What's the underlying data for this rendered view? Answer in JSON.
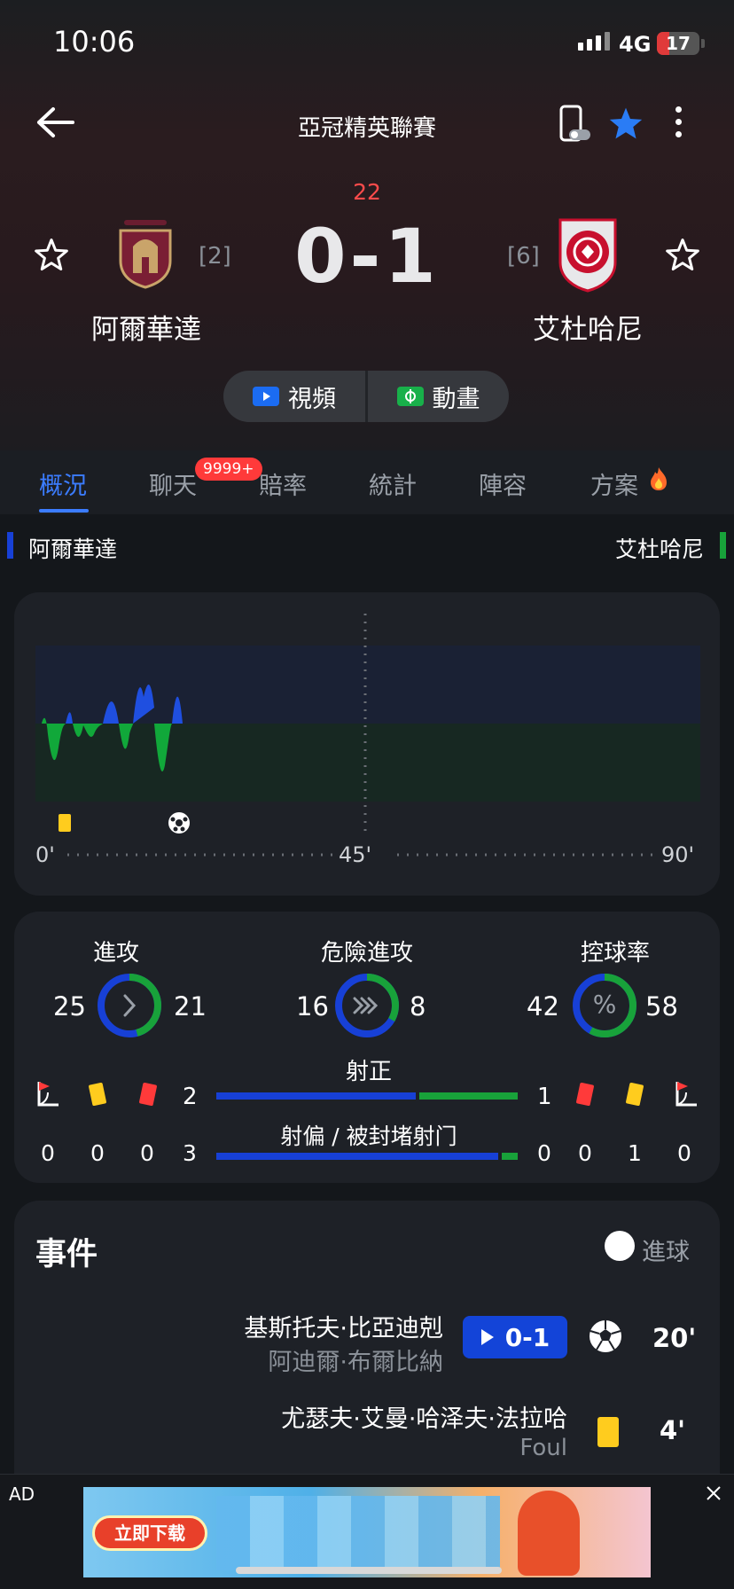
{
  "status": {
    "time": "10:06",
    "network": "4G",
    "battery": "17"
  },
  "header": {
    "title": "亞冠精英聯賽",
    "minute": "22",
    "score": "0-1",
    "home": {
      "name": "阿爾華達",
      "rank": "[2]"
    },
    "away": {
      "name": "艾杜哈尼",
      "rank": "[6]"
    },
    "video_label": "視頻",
    "animation_label": "動畫"
  },
  "tabs": {
    "items": [
      "概況",
      "聊天",
      "賠率",
      "統計",
      "陣容",
      "方案"
    ],
    "active": "概況",
    "chat_badge": "9999+"
  },
  "teams_bar": {
    "home": "阿爾華達",
    "away": "艾杜哈尼",
    "home_color": "#1740d6",
    "away_color": "#18a23a"
  },
  "momentum": {
    "start": "0'",
    "mid": "45'",
    "end": "90'"
  },
  "stats": {
    "attack": {
      "label": "進攻",
      "home": "25",
      "away": "21",
      "away_share": 0.457
    },
    "dangerous": {
      "label": "危險進攻",
      "home": "16",
      "away": "8",
      "away_share": 0.333
    },
    "possession": {
      "label": "控球率",
      "home": "42",
      "away": "58",
      "away_share": 0.58,
      "symbol": "%"
    },
    "shots_on": {
      "label": "射正",
      "home": "2",
      "away": "1",
      "home_share": 0.667
    },
    "shots_off": {
      "label": "射偏 / 被封堵射门",
      "home": "3",
      "away": "0",
      "home_share": 0.94
    },
    "home_counts": {
      "corners": "0",
      "yellow": "0",
      "red": "0"
    },
    "away_counts": {
      "red": "0",
      "yellow": "1",
      "corners": "0"
    }
  },
  "events": {
    "title": "事件",
    "legend": "進球",
    "items": [
      {
        "player": "基斯托夫·比亞迪剋",
        "assist": "阿迪爾·布爾比納",
        "score": "0-1",
        "minute": "20'",
        "type": "goal"
      },
      {
        "player": "尤瑟夫·艾曼·哈泽夫·法拉哈",
        "reason": "Foul",
        "minute": "4'",
        "type": "yellow"
      }
    ]
  },
  "ad": {
    "label": "AD",
    "button": "立即下载"
  }
}
